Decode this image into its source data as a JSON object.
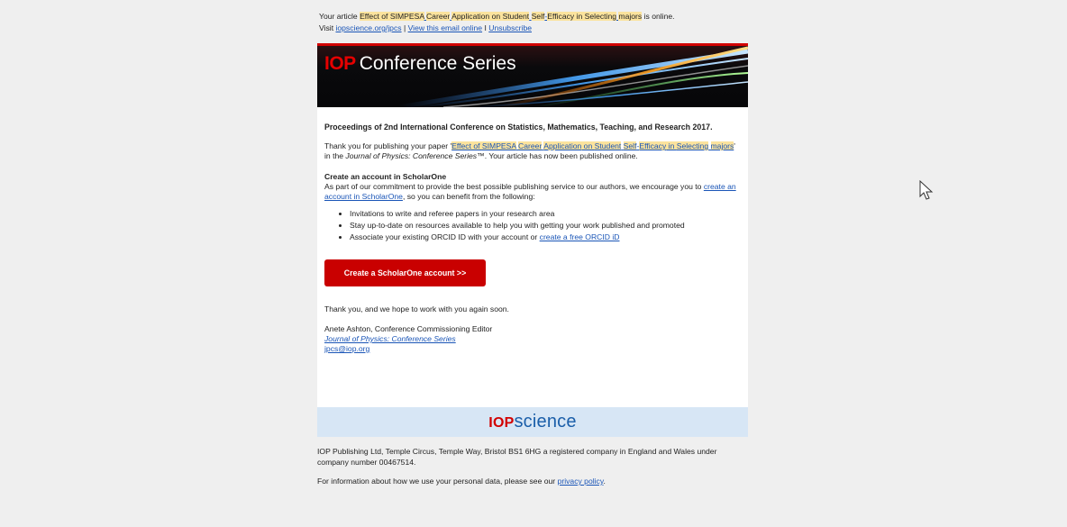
{
  "preheader": {
    "line1_prefix": "Your article ",
    "title_words": [
      "Effect",
      " of ",
      "SIMPESA",
      " ",
      "Career",
      " ",
      "Application",
      " on ",
      "Student",
      " ",
      "Self",
      "-",
      "Efficacy",
      " in ",
      "Selecting",
      " ",
      "majors"
    ],
    "line1_suffix": " is online.",
    "visit_prefix": "Visit ",
    "link_site": "iopscience.org/jpcs",
    "sep1": " | ",
    "link_view": "View this email online",
    "sep2": " I ",
    "link_unsub": "Unsubscribe"
  },
  "banner": {
    "brand": "IOP",
    "title": "Conference Series"
  },
  "content": {
    "proceedings": "Proceedings of 2nd International Conference on Statistics, Mathematics, Teaching, and Research 2017.",
    "thanks_prefix": "Thank you for publishing your paper '",
    "paper_title_words": [
      "Effect",
      " of ",
      "SIMPESA",
      " ",
      "Career",
      " ",
      "Application",
      " on ",
      "Student",
      " ",
      "Self",
      "-",
      "Efficacy",
      " in ",
      "Selecting",
      " ",
      "majors"
    ],
    "thanks_mid": "' in the ",
    "journal_italic": "Journal of Physics: Conference Series",
    "thanks_suffix": "™. Your article has now been published online.",
    "section_title": "Create an account in ScholarOne",
    "section_text_prefix": "As part of our commitment to provide the best possible publishing service to our authors, we encourage you to ",
    "section_link": "create an account in ScholarOne",
    "section_text_suffix": ", so you can benefit from the following:",
    "benefits": [
      "Invitations to write and referee papers in your research area",
      "Stay up-to-date on resources available to help you with getting your work published and promoted",
      "Associate your existing ORCID ID with your account or "
    ],
    "orcid_link": "create a free ORCID iD",
    "cta_label": "Create a ScholarOne account >>",
    "closing": "Thank you, and we hope to work with you again soon.",
    "signature_name": "Anete Ashton, Conference Commissioning Editor",
    "signature_journal": "Journal of Physics: Conference Series",
    "signature_email": "jpcs@iop.org"
  },
  "footer": {
    "logo_brand": "IOP",
    "logo_rest": "science",
    "company": "IOP Publishing Ltd, Temple Circus, Temple Way, Bristol BS1 6HG a registered company in England and Wales under company number 00467514.",
    "privacy_prefix": "For information about how we use your personal data, please see our ",
    "privacy_link": "privacy policy",
    "privacy_suffix": "."
  },
  "colors": {
    "accent_red": "#c90000",
    "link_blue": "#1a55b7",
    "highlight": "#fbe39d",
    "footer_band": "#d7e6f5"
  },
  "icons": {
    "cursor": "mouse-pointer-icon"
  }
}
